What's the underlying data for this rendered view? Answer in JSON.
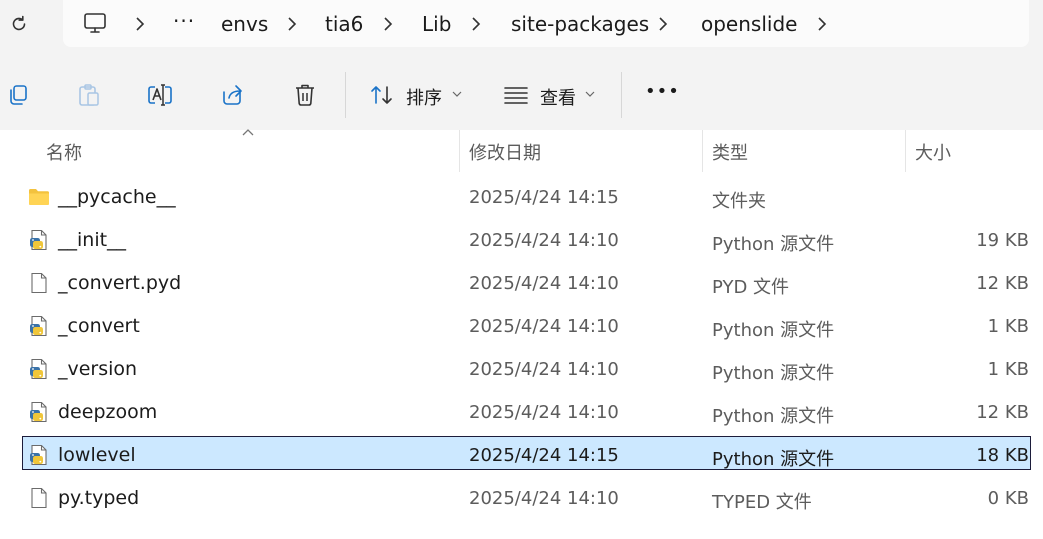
{
  "breadcrumb": {
    "overflow": "···",
    "items": [
      "envs",
      "tia6",
      "Lib",
      "site-packages",
      "openslide"
    ]
  },
  "toolbar": {
    "sort_label": "排序",
    "view_label": "查看",
    "more_label": "•••"
  },
  "columns": {
    "name": "名称",
    "date": "修改日期",
    "type": "类型",
    "size": "大小"
  },
  "files": [
    {
      "name": "__pycache__",
      "date": "2025/4/24 14:15",
      "type": "文件夹",
      "size": "",
      "icon": "folder-icon"
    },
    {
      "name": "__init__",
      "date": "2025/4/24 14:10",
      "type": "Python 源文件",
      "size": "19 KB",
      "icon": "python-file-icon"
    },
    {
      "name": "_convert.pyd",
      "date": "2025/4/24 14:10",
      "type": "PYD 文件",
      "size": "12 KB",
      "icon": "file-icon"
    },
    {
      "name": "_convert",
      "date": "2025/4/24 14:10",
      "type": "Python 源文件",
      "size": "1 KB",
      "icon": "python-file-icon"
    },
    {
      "name": "_version",
      "date": "2025/4/24 14:10",
      "type": "Python 源文件",
      "size": "1 KB",
      "icon": "python-file-icon"
    },
    {
      "name": "deepzoom",
      "date": "2025/4/24 14:10",
      "type": "Python 源文件",
      "size": "12 KB",
      "icon": "python-file-icon"
    },
    {
      "name": "lowlevel",
      "date": "2025/4/24 14:15",
      "type": "Python 源文件",
      "size": "18 KB",
      "icon": "python-file-icon",
      "selected": true
    },
    {
      "name": "py.typed",
      "date": "2025/4/24 14:10",
      "type": "TYPED 文件",
      "size": "0 KB",
      "icon": "file-icon"
    }
  ],
  "colors": {
    "selection": "#cce8ff",
    "toolbar_bg": "#f3f3f3",
    "accent": "#1a73c8"
  }
}
